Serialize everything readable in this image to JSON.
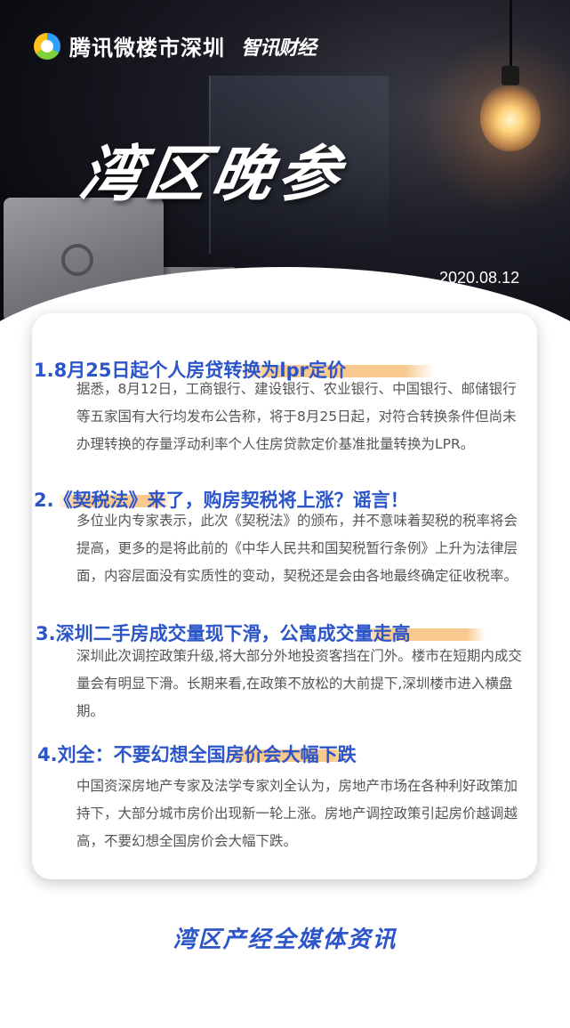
{
  "brand": {
    "name": "腾讯微楼市深圳",
    "sub": "智讯财经"
  },
  "hero": {
    "title": "湾区晚参",
    "date": "2020.08.12"
  },
  "items": [
    {
      "title": "1.8月25日起个人房贷转换为lpr定价",
      "body": "据悉，8月12日，工商银行、建设银行、农业银行、中国银行、邮储银行等五家国有大行均发布公告称，将于8月25日起，对符合转换条件但尚未办理转换的存量浮动利率个人住房贷款定价基准批量转换为LPR。"
    },
    {
      "title": "2.《契税法》来了，购房契税将上涨？谣言！",
      "body": "多位业内专家表示，此次《契税法》的颁布，并不意味着契税的税率将会提高，更多的是将此前的《中华人民共和国契税暂行条例》上升为法律层面，内容层面没有实质性的变动，契税还是会由各地最终确定征收税率。"
    },
    {
      "title": "3.深圳二手房成交量现下滑，公寓成交量走高",
      "body": "深圳此次调控政策升级,将大部分外地投资客挡在门外。楼市在短期内成交量会有明显下滑。长期来看,在政策不放松的大前提下,深圳楼市进入横盘期。"
    },
    {
      "title": "4.刘全：不要幻想全国房价会大幅下跌",
      "body": "中国资深房地产专家及法学专家刘全认为，房地产市场在各种利好政策加持下，大部分城市房价出现新一轮上涨。房地产调控政策引起房价越调越高，不要幻想全国房价会大幅下跌。"
    }
  ],
  "footer": {
    "text": "湾区产经全媒体资讯"
  }
}
